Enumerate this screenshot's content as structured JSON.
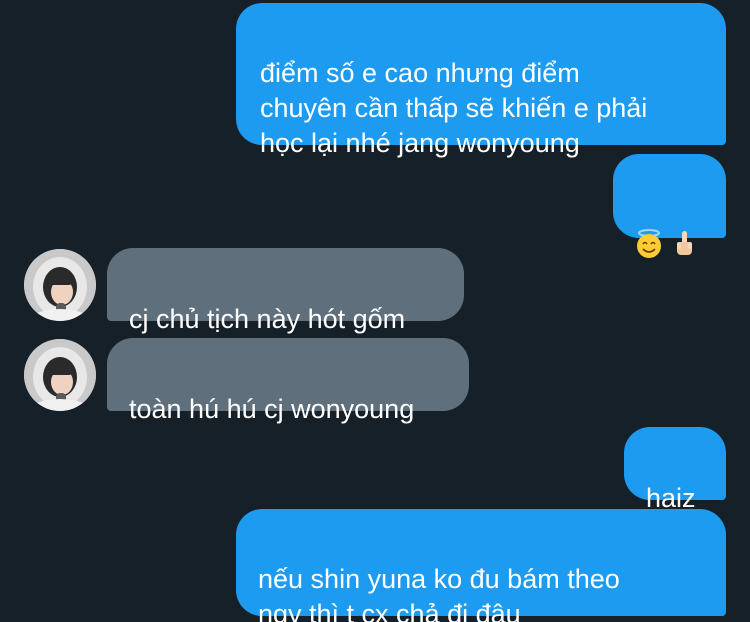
{
  "messages": [
    {
      "sender": "me",
      "text": "điểm số e cao nhưng điểm\nchuyên cần thấp sẽ khiến e phải\nhọc lại nhé jang wonyoung"
    },
    {
      "sender": "me",
      "emojis": [
        "smiling-face-with-halo",
        "middle-finger"
      ]
    },
    {
      "sender": "other",
      "text": "cj chủ tịch này hót gốm"
    },
    {
      "sender": "other",
      "text": "toàn hú hú cj wonyoung"
    },
    {
      "sender": "me",
      "text": "haiz"
    },
    {
      "sender": "me",
      "text": "nếu shin yuna ko đu bám theo\nngy thì t cx chả đi đâu"
    }
  ],
  "colors": {
    "background": "#162029",
    "sent_bubble": "#1d9bf0",
    "received_bubble": "#5f6f7b",
    "text": "#ffffff"
  }
}
